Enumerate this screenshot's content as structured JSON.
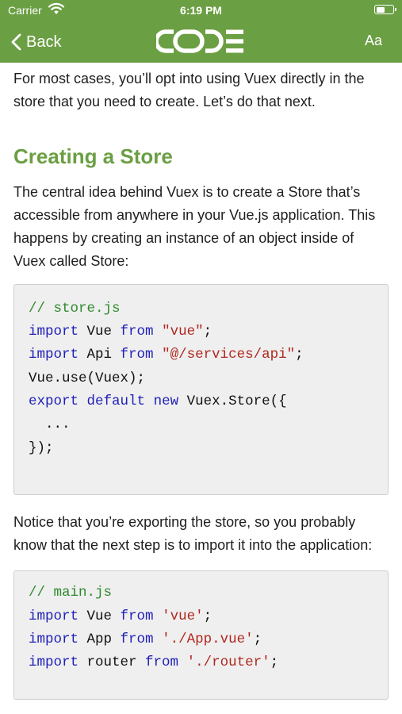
{
  "status": {
    "carrier": "Carrier",
    "time": "6:19 PM"
  },
  "nav": {
    "back_label": "Back",
    "logo_text": "CODE",
    "font_button": "Aa"
  },
  "article": {
    "intro": "For most cases, you’ll opt into using Vuex directly in the store that you need to create. Let’s do that next.",
    "heading": "Creating a Store",
    "para1": "The central idea behind Vuex is to create a Store that’s accessible from anywhere in your Vue.js application. This happens by creating an instance of an object inside of Vuex called Store:",
    "code1": [
      [
        {
          "t": "// store.js",
          "c": "c"
        }
      ],
      [
        {
          "t": "import",
          "c": "k"
        },
        {
          "t": " Vue "
        },
        {
          "t": "from",
          "c": "k"
        },
        {
          "t": " "
        },
        {
          "t": "\"vue\"",
          "c": "s"
        },
        {
          "t": ";"
        }
      ],
      [
        {
          "t": "import",
          "c": "k"
        },
        {
          "t": " Api "
        },
        {
          "t": "from",
          "c": "k"
        },
        {
          "t": " "
        },
        {
          "t": "\"@/services/api\"",
          "c": "s"
        },
        {
          "t": ";"
        }
      ],
      [
        {
          "t": "Vue.use(Vuex);"
        }
      ],
      [
        {
          "t": "export",
          "c": "k"
        },
        {
          "t": " "
        },
        {
          "t": "default",
          "c": "k"
        },
        {
          "t": " "
        },
        {
          "t": "new",
          "c": "k"
        },
        {
          "t": " Vuex.Store({"
        }
      ],
      [
        {
          "t": "  ..."
        }
      ],
      [
        {
          "t": "});"
        }
      ]
    ],
    "para2": "Notice that you’re exporting the store, so you probably know that the next step is to import it into the application:",
    "code2": [
      [
        {
          "t": "// main.js",
          "c": "c"
        }
      ],
      [
        {
          "t": "import",
          "c": "k"
        },
        {
          "t": " Vue "
        },
        {
          "t": "from",
          "c": "k"
        },
        {
          "t": " "
        },
        {
          "t": "'vue'",
          "c": "s"
        },
        {
          "t": ";"
        }
      ],
      [
        {
          "t": "import",
          "c": "k"
        },
        {
          "t": " App "
        },
        {
          "t": "from",
          "c": "k"
        },
        {
          "t": " "
        },
        {
          "t": "'./App.vue'",
          "c": "s"
        },
        {
          "t": ";"
        }
      ],
      [
        {
          "t": "import",
          "c": "k"
        },
        {
          "t": " router "
        },
        {
          "t": "from",
          "c": "k"
        },
        {
          "t": " "
        },
        {
          "t": "'./router'",
          "c": "s"
        },
        {
          "t": ";"
        }
      ]
    ]
  },
  "colors": {
    "accent": "#6b9f43",
    "keyword": "#1f1fb8",
    "string": "#b0281f",
    "comment": "#2f8a2c",
    "code_bg": "#efefef"
  }
}
